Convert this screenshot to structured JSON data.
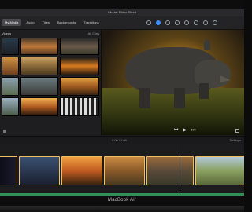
{
  "window": {
    "title": "iMovie: Rhino Shoot"
  },
  "toolbar": {
    "tabs": [
      {
        "label": "My Media",
        "active": true
      },
      {
        "label": "Audio",
        "active": false
      },
      {
        "label": "Titles",
        "active": false
      },
      {
        "label": "Backgrounds",
        "active": false
      },
      {
        "label": "Transitions",
        "active": false
      }
    ],
    "icons": [
      "color-balance-icon",
      "color-correction-icon",
      "crop-icon",
      "stabilization-icon",
      "volume-icon",
      "noise-reduction-icon",
      "speed-icon",
      "info-icon"
    ]
  },
  "library": {
    "header_left": "Videos",
    "header_right": "All Clips"
  },
  "viewer": {
    "controls": {
      "prev": "⏮",
      "play": "▶",
      "next": "⏭"
    }
  },
  "midbar": {
    "timecode": "0:00 / 1:06",
    "settings": "Settings"
  },
  "device": {
    "label": "MacBook Air"
  },
  "colors": {
    "accent": "#3c8cff",
    "audio": "#2f8f55",
    "clip_border": "#f0c060"
  }
}
